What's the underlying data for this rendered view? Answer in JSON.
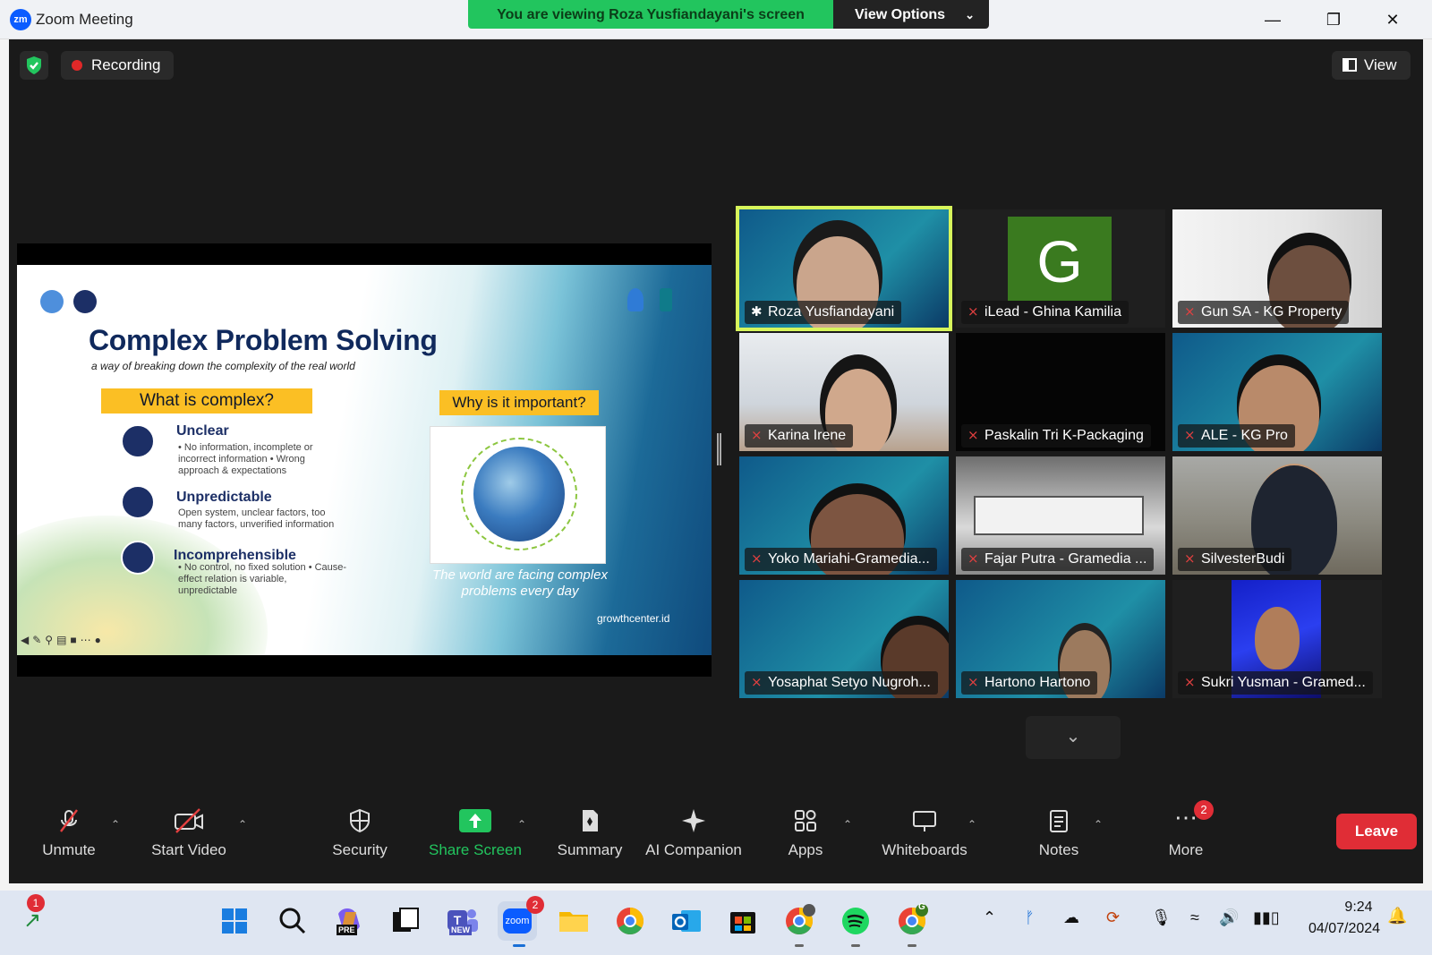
{
  "window": {
    "title": "Zoom Meeting",
    "logo_text": "zm"
  },
  "banner": {
    "viewing_text": "You are viewing Roza Yusfiandayani's screen",
    "view_options_label": "View Options"
  },
  "top_bar": {
    "recording_label": "Recording",
    "view_label": "View"
  },
  "slide": {
    "title": "Complex Problem Solving",
    "subtitle": "a way of breaking down the complexity of the real world",
    "left_heading": "What is complex?",
    "right_heading": "Why is it important?",
    "items": [
      {
        "title": "Unclear",
        "desc": "• No information, incomplete or incorrect information • Wrong approach & expectations"
      },
      {
        "title": "Unpredictable",
        "desc": "Open system, unclear factors, too many factors, unverified information"
      },
      {
        "title": "Incomprehensible",
        "desc": "• No control, no fixed solution • Cause-effect relation is variable, unpredictable"
      }
    ],
    "caption": "The world are facing complex problems every day",
    "url": "growthcenter.id"
  },
  "participants": [
    {
      "name": "Roza Yusfiandayani",
      "active": true
    },
    {
      "name": "iLead - Ghina Kamilia",
      "avatar_letter": "G"
    },
    {
      "name": "Gun SA - KG Property"
    },
    {
      "name": "Karina Irene"
    },
    {
      "name": "Paskalin Tri K-Packaging"
    },
    {
      "name": "ALE - KG Pro"
    },
    {
      "name": "Yoko Mariahi-Gramedia..."
    },
    {
      "name": "Fajar Putra - Gramedia ..."
    },
    {
      "name": "SilvesterBudi"
    },
    {
      "name": "Yosaphat Setyo Nugroh..."
    },
    {
      "name": "Hartono Hartono"
    },
    {
      "name": "Sukri Yusman - Gramed..."
    }
  ],
  "toolbar": {
    "unmute": "Unmute",
    "start_video": "Start Video",
    "security": "Security",
    "share_screen": "Share Screen",
    "summary": "Summary",
    "ai_companion": "AI Companion",
    "apps": "Apps",
    "whiteboards": "Whiteboards",
    "notes": "Notes",
    "more": "More",
    "more_badge": "2",
    "leave": "Leave"
  },
  "taskbar": {
    "stocks_badge": "1",
    "zoom_badge": "2",
    "zoom_label": "zoom",
    "pre_label": "PRE",
    "new_label": "NEW",
    "chrome_profile": "G",
    "time": "9:24",
    "date": "04/07/2024"
  },
  "colors": {
    "accent_green": "#22c55e",
    "leave_red": "#e02d36",
    "active_speaker": "#d7f55b",
    "zoom_blue": "#0b5cff"
  }
}
